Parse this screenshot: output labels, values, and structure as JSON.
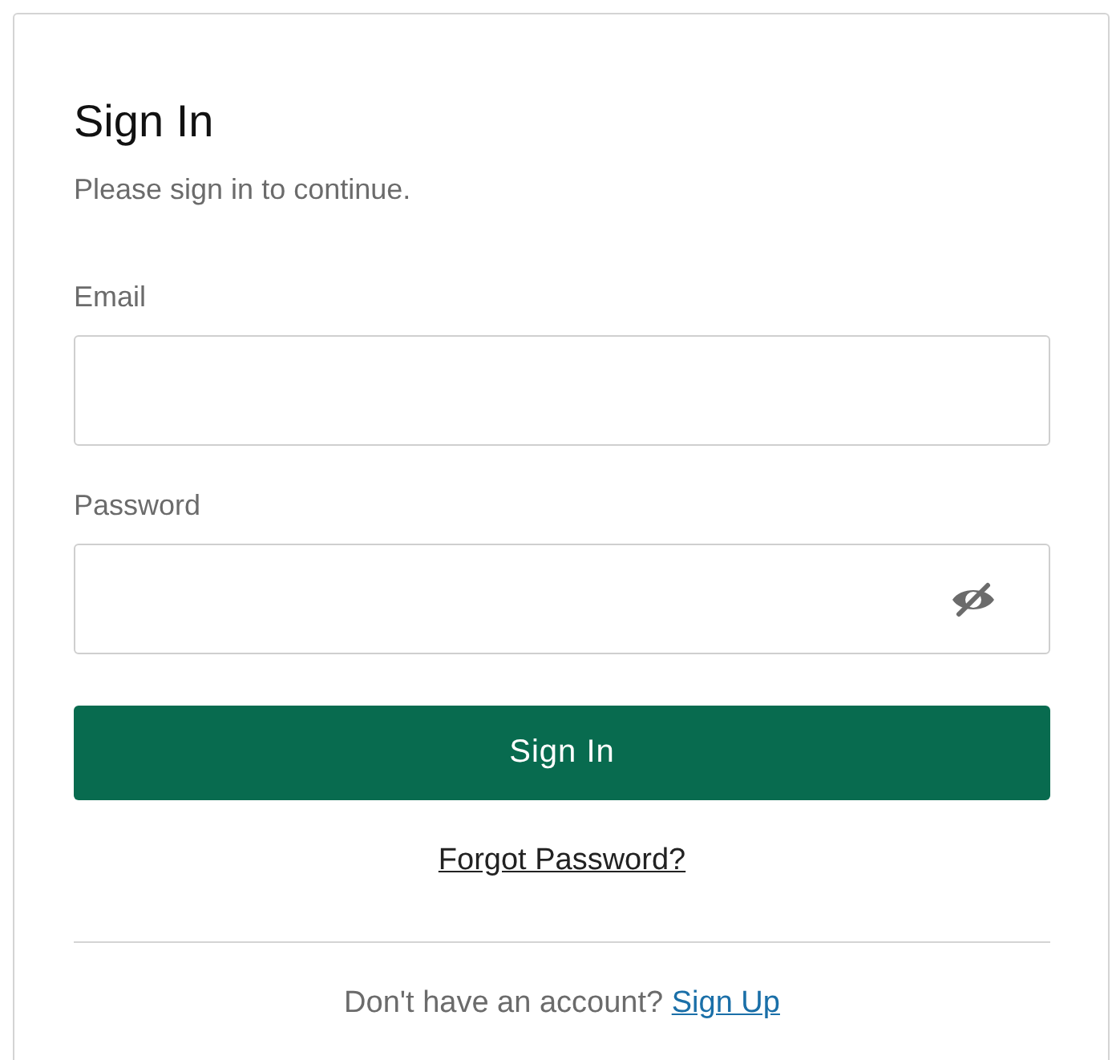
{
  "title": "Sign In",
  "subtitle": "Please sign in to continue.",
  "fields": [
    {
      "label": "Email",
      "kind": "text"
    },
    {
      "label": "Password",
      "kind": "password"
    }
  ],
  "submit_button": "Sign In",
  "forgot_link": "Forgot Password?",
  "signup": {
    "prompt": "Don't have an account?",
    "link": "Sign Up"
  }
}
